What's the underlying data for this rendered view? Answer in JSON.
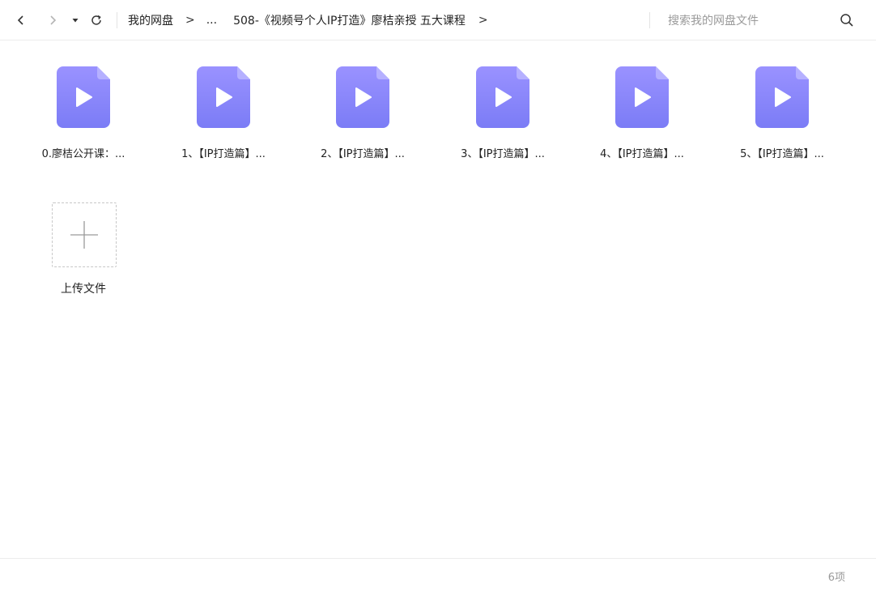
{
  "toolbar": {
    "breadcrumb": {
      "root": "我的网盘",
      "separator": ">",
      "ellipsis": "...",
      "current": "508-《视频号个人IP打造》廖桔亲授 五大课程",
      "trailing_separator": ">"
    },
    "search_placeholder": "搜索我的网盘文件"
  },
  "files": [
    {
      "name": "0.廖桔公开课：...",
      "type": "video"
    },
    {
      "name": "1、【IP打造篇】...",
      "type": "video"
    },
    {
      "name": "2、【IP打造篇】...",
      "type": "video"
    },
    {
      "name": "3、【IP打造篇】...",
      "type": "video"
    },
    {
      "name": "4、【IP打造篇】...",
      "type": "video"
    },
    {
      "name": "5、【IP打造篇】...",
      "type": "video"
    }
  ],
  "upload": {
    "label": "上传文件",
    "icon": "plus-icon"
  },
  "status": {
    "count_label": "6项"
  },
  "colors": {
    "file_icon_top": "#9a92ff",
    "file_icon_bottom": "#7b7cf6",
    "accent": "#7c7cf7"
  }
}
